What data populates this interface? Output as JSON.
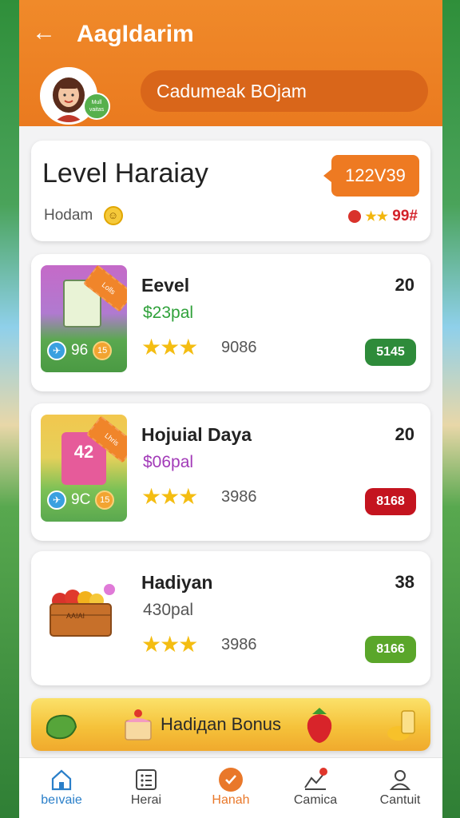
{
  "header": {
    "title": "AagIdarim",
    "avatar_badge": "Mull vaitas",
    "name_pill": "Cadumeak BOjam"
  },
  "level": {
    "title": "Level Haraiay",
    "badge": "122V39",
    "subtitle": "Hodam",
    "right_value": "99#"
  },
  "items": [
    {
      "title": "Eevel",
      "number": "20",
      "price": "$23pal",
      "price_color": "#2fa13a",
      "rating": 3,
      "count": "9086",
      "badge": "5145",
      "badge_color": "#2e8b3a",
      "thumb_value": "96",
      "thumb_coin": "15",
      "tag_text": "Lolls"
    },
    {
      "title": "Hojuial Daya",
      "number": "20",
      "price": "$06pal",
      "price_color": "#a23ab8",
      "rating": 3,
      "count": "3986",
      "badge": "8168",
      "badge_color": "#c4141f",
      "thumb_value": "9C",
      "thumb_coin": "15",
      "tag_text": "Lhris",
      "can_number": "42"
    },
    {
      "title": "Hadiyan",
      "number": "38",
      "price": "430pal",
      "price_color": "#555555",
      "rating": 3,
      "count": "3986",
      "badge": "8166",
      "badge_color": "#5aa62a",
      "crate_label": "AAIAI"
    }
  ],
  "bonus": {
    "label": "Hadiдan Bonus"
  },
  "nav": [
    {
      "label": "beıvaie",
      "icon": "home-icon"
    },
    {
      "label": "Herai",
      "icon": "grid-icon"
    },
    {
      "label": "Hanah",
      "icon": "check-circle-icon"
    },
    {
      "label": "Camica",
      "icon": "chart-icon"
    },
    {
      "label": "Cantuit",
      "icon": "user-icon"
    }
  ]
}
